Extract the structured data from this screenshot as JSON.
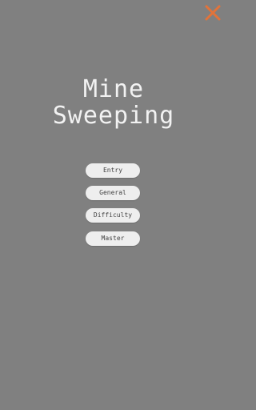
{
  "colors": {
    "background": "#808080",
    "title_text": "#f2f2f2",
    "button_bg": "#eeeeee",
    "button_text": "#444444",
    "close_icon": "#e2733a"
  },
  "header": {
    "close_icon": "close-icon"
  },
  "title": {
    "line1": "Mine",
    "line2": "Sweeping"
  },
  "menu": {
    "items": [
      {
        "label": "Entry"
      },
      {
        "label": "General"
      },
      {
        "label": "Difficulty"
      },
      {
        "label": "Master"
      }
    ]
  }
}
